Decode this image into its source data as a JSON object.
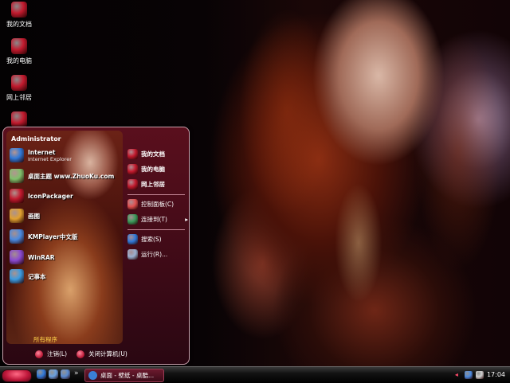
{
  "desktop": {
    "icons": [
      {
        "label": "我的文档",
        "icon": "my-documents-icon",
        "color": "#c21a2e"
      },
      {
        "label": "我的电脑",
        "icon": "my-computer-icon",
        "color": "#c21a2e"
      },
      {
        "label": "网上邻居",
        "icon": "network-places-icon",
        "color": "#c21a2e"
      },
      {
        "label": "",
        "icon": "recycle-bin-icon",
        "color": "#c21a2e"
      }
    ]
  },
  "start_menu": {
    "user": "Administrator",
    "pinned": [
      {
        "title": "Internet",
        "subtitle": "Internet Explorer",
        "icon": "internet-explorer-icon",
        "color": "#2f78d8"
      },
      {
        "title": "桌面主题 www.ZhuoKu.com",
        "icon": "theme-icon",
        "color": "#7fbf6a"
      },
      {
        "title": "IconPackager",
        "icon": "iconpackager-icon",
        "color": "#c21a2e"
      },
      {
        "title": "画图",
        "icon": "paint-icon",
        "color": "#e0a030"
      },
      {
        "title": "KMPlayer中文版",
        "icon": "kmplayer-icon",
        "color": "#4a8ae0"
      },
      {
        "title": "WinRAR",
        "icon": "winrar-icon",
        "color": "#8a4ad0"
      },
      {
        "title": "记事本",
        "icon": "notepad-icon",
        "color": "#3a9ae0"
      }
    ],
    "all_programs": "所有程序",
    "right": [
      {
        "label": "我的文档",
        "icon": "my-documents-icon",
        "color": "#c21a2e",
        "bold": true
      },
      {
        "label": "我的电脑",
        "icon": "my-computer-icon",
        "color": "#c21a2e",
        "bold": true
      },
      {
        "label": "网上邻居",
        "icon": "network-places-icon",
        "color": "#c21a2e",
        "bold": true
      },
      {
        "label": "控制面板(C)",
        "icon": "control-panel-icon",
        "color": "#e05050"
      },
      {
        "label": "连接到(T)",
        "icon": "connect-to-icon",
        "color": "#3a9a5a",
        "arrow": "▸"
      },
      {
        "label": "搜索(S)",
        "icon": "search-icon",
        "color": "#2f78d8"
      },
      {
        "label": "运行(R)...",
        "icon": "run-icon",
        "color": "#9ab0d0"
      }
    ],
    "logoff": "注销(L)",
    "shutdown": "关闭计算机(U)"
  },
  "taskbar": {
    "quick_launch": [
      {
        "icon": "internet-explorer-icon",
        "color": "#2f78d8"
      },
      {
        "icon": "media-player-icon",
        "color": "#6aa0e0"
      },
      {
        "icon": "show-desktop-icon",
        "color": "#5a8ad0"
      }
    ],
    "chevron": "»",
    "task": "桌面 - 壁纸 - 桌酷...",
    "tray_arrow": "◂",
    "tray_icons": [
      {
        "icon": "network-tray-icon",
        "color": "#4a8ae0"
      },
      {
        "icon": "volume-tray-icon",
        "color": "#cfcfcf"
      }
    ],
    "clock": "17:04"
  }
}
